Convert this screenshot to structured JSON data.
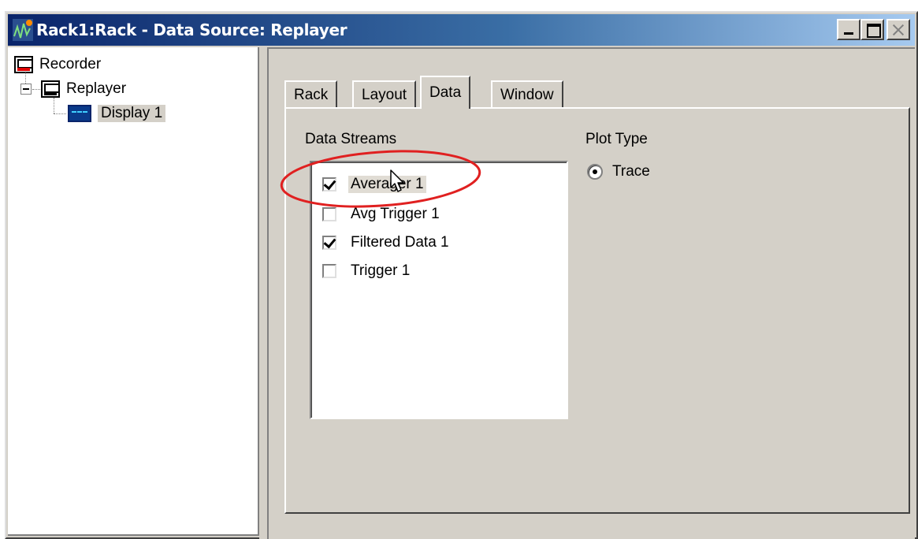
{
  "window": {
    "title": "Rack1:Rack - Data Source: Replayer",
    "controls": {
      "minimize": "minimize-button",
      "maximize": "maximize-button",
      "close": "close-button"
    }
  },
  "tree": {
    "items": [
      {
        "label": "Recorder",
        "icon": "recorder-icon"
      },
      {
        "label": "Replayer",
        "icon": "replayer-icon"
      },
      {
        "label": "Display 1",
        "icon": "display-icon",
        "selected": true
      }
    ]
  },
  "tabs": [
    {
      "label": "Rack"
    },
    {
      "label": "Layout"
    },
    {
      "label": "Data",
      "active": true
    },
    {
      "label": "Window"
    }
  ],
  "data_tab": {
    "streams_label": "Data Streams",
    "streams": [
      {
        "label": "Averager 1",
        "checked": true
      },
      {
        "label": "Avg Trigger 1",
        "checked": false
      },
      {
        "label": "Filtered Data 1",
        "checked": true
      },
      {
        "label": "Trigger 1",
        "checked": false
      }
    ],
    "plot_type_label": "Plot Type",
    "plot_type_options": [
      {
        "label": "Trace",
        "selected": true
      }
    ]
  },
  "colors": {
    "annotation": "#e02020",
    "titlebar": "#0a246a",
    "face": "#d4d0c8"
  }
}
